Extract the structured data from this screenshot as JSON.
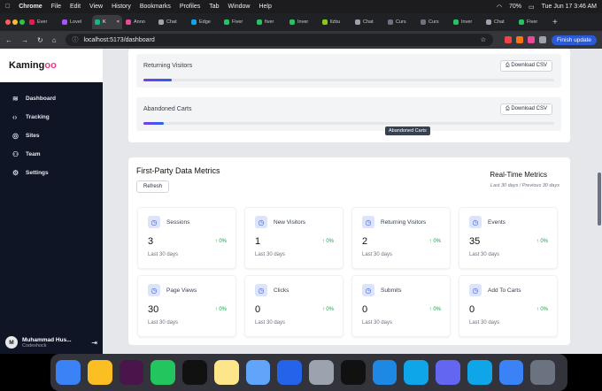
{
  "menubar": {
    "app": "Chrome",
    "items": [
      "File",
      "Edit",
      "View",
      "History",
      "Bookmarks",
      "Profiles",
      "Tab",
      "Window",
      "Help"
    ],
    "battery": "70%",
    "datetime": "Tue Jun 17  3:46 AM"
  },
  "tabs": [
    {
      "label": "Ever",
      "color": "#e11d48"
    },
    {
      "label": "Lovel",
      "color": "#a855f7"
    },
    {
      "label": "K",
      "color": "#10b981",
      "active": true
    },
    {
      "label": "Anno",
      "color": "#ec4899"
    },
    {
      "label": "Chat",
      "color": "#9ca3af"
    },
    {
      "label": "Edge",
      "color": "#0ea5e9"
    },
    {
      "label": "Fiver",
      "color": "#22c55e"
    },
    {
      "label": "fiver",
      "color": "#22c55e"
    },
    {
      "label": "Inver",
      "color": "#22c55e"
    },
    {
      "label": "llzbu",
      "color": "#84cc16"
    },
    {
      "label": "Chat",
      "color": "#9ca3af"
    },
    {
      "label": "Curs",
      "color": "#6b7280"
    },
    {
      "label": "Curs",
      "color": "#6b7280"
    },
    {
      "label": "Inver",
      "color": "#22c55e"
    },
    {
      "label": "Chat",
      "color": "#9ca3af"
    },
    {
      "label": "Fiver",
      "color": "#22c55e"
    }
  ],
  "address": {
    "url": "localhost:5173/dashboard",
    "finish": "Finish update"
  },
  "sidebar": {
    "logo_main": "Kaming",
    "logo_accent": "oo",
    "items": [
      {
        "label": "Dashboard",
        "icon": "≋"
      },
      {
        "label": "Tracking",
        "icon": "‹›"
      },
      {
        "label": "Sites",
        "icon": "◎"
      },
      {
        "label": "Team",
        "icon": "⚇"
      },
      {
        "label": "Settings",
        "icon": "⚙"
      }
    ],
    "user": {
      "initial": "M",
      "name": "Muhammad Hus...",
      "org": "Codeshock"
    }
  },
  "top_rows": [
    {
      "label": "Returning Visitors",
      "button": "Download CSV",
      "progress": 0.07
    },
    {
      "label": "Abandoned Carts",
      "button": "Download CSV",
      "progress": 0.05
    }
  ],
  "tooltip": "Abandoned Carts",
  "first_party": {
    "title": "First-Party Data Metrics",
    "refresh": "Refresh",
    "realtime_title": "Real-Time Metrics",
    "realtime_sub": "Last 30 days / Previous 30 days",
    "metrics": [
      {
        "name": "Sessions",
        "value": "3",
        "change": "↑ 0%",
        "sub": "Last 30 days"
      },
      {
        "name": "New Visitors",
        "value": "1",
        "change": "↑ 0%",
        "sub": "Last 30 days"
      },
      {
        "name": "Returning Visitors",
        "value": "2",
        "change": "↑ 0%",
        "sub": "Last 30 days"
      },
      {
        "name": "Events",
        "value": "35",
        "change": "↑ 0%",
        "sub": "Last 30 days"
      },
      {
        "name": "Page Views",
        "value": "30",
        "change": "↑ 0%",
        "sub": "Last 30 days"
      },
      {
        "name": "Clicks",
        "value": "0",
        "change": "↑ 0%",
        "sub": "Last 30 days"
      },
      {
        "name": "Submits",
        "value": "0",
        "change": "↑ 0%",
        "sub": "Last 30 days"
      },
      {
        "name": "Add To Carts",
        "value": "0",
        "change": "↑ 0%",
        "sub": "Last 30 days"
      }
    ]
  },
  "dock": [
    {
      "name": "finder",
      "color": "#3b82f6"
    },
    {
      "name": "chrome",
      "color": "#fbbf24"
    },
    {
      "name": "slack",
      "color": "#4a154b"
    },
    {
      "name": "whatsapp",
      "color": "#22c55e"
    },
    {
      "name": "cursor",
      "color": "#111111"
    },
    {
      "name": "notes",
      "color": "#fde68a"
    },
    {
      "name": "xcode",
      "color": "#60a5fa"
    },
    {
      "name": "app-store",
      "color": "#2563eb"
    },
    {
      "name": "system-settings",
      "color": "#9ca3af"
    },
    {
      "name": "terminal",
      "color": "#111111"
    },
    {
      "name": "vscode",
      "color": "#1e88e5"
    },
    {
      "name": "edge",
      "color": "#0ea5e9"
    },
    {
      "name": "teams",
      "color": "#6366f1"
    },
    {
      "name": "docker",
      "color": "#0ea5e9"
    },
    {
      "name": "safari",
      "color": "#3b82f6"
    },
    {
      "name": "trash",
      "color": "#6b7280"
    }
  ]
}
